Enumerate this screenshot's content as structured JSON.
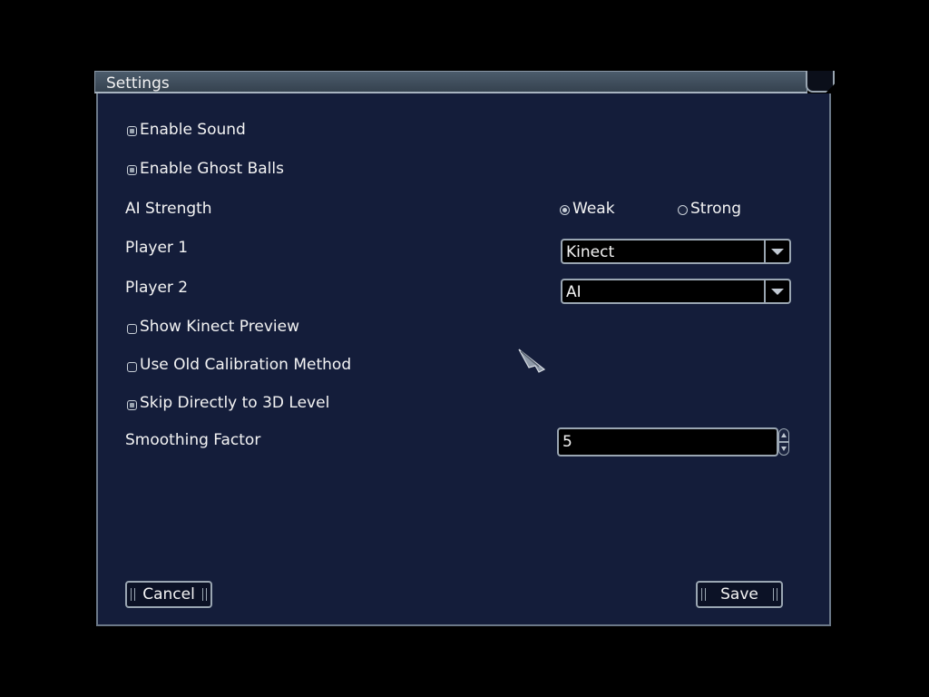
{
  "window": {
    "title": "Settings"
  },
  "options": {
    "enable_sound": {
      "label": "Enable Sound",
      "checked": true
    },
    "enable_ghost_balls": {
      "label": "Enable Ghost Balls",
      "checked": true
    },
    "ai_strength": {
      "label": "AI Strength",
      "choices": [
        {
          "label": "Weak",
          "selected": true
        },
        {
          "label": "Strong",
          "selected": false
        }
      ]
    },
    "player1": {
      "label": "Player 1",
      "value": "Kinect"
    },
    "player2": {
      "label": "Player 2",
      "value": "AI"
    },
    "show_kinect_preview": {
      "label": "Show Kinect Preview",
      "checked": false
    },
    "use_old_calibration": {
      "label": "Use Old Calibration Method",
      "checked": false
    },
    "skip_to_3d": {
      "label": "Skip Directly to 3D Level",
      "checked": true
    },
    "smoothing_factor": {
      "label": "Smoothing Factor",
      "value": "5"
    }
  },
  "buttons": {
    "cancel": "Cancel",
    "save": "Save"
  },
  "icons": {
    "close": "close-icon",
    "dropdown": "chevron-down-icon",
    "cursor": "arrow-cursor-icon"
  },
  "colors": {
    "background": "#000000",
    "panel": "#141d3a",
    "titlebar": "#3f4d5c",
    "border": "#9aa6b2",
    "text": "#f4f4f4"
  }
}
